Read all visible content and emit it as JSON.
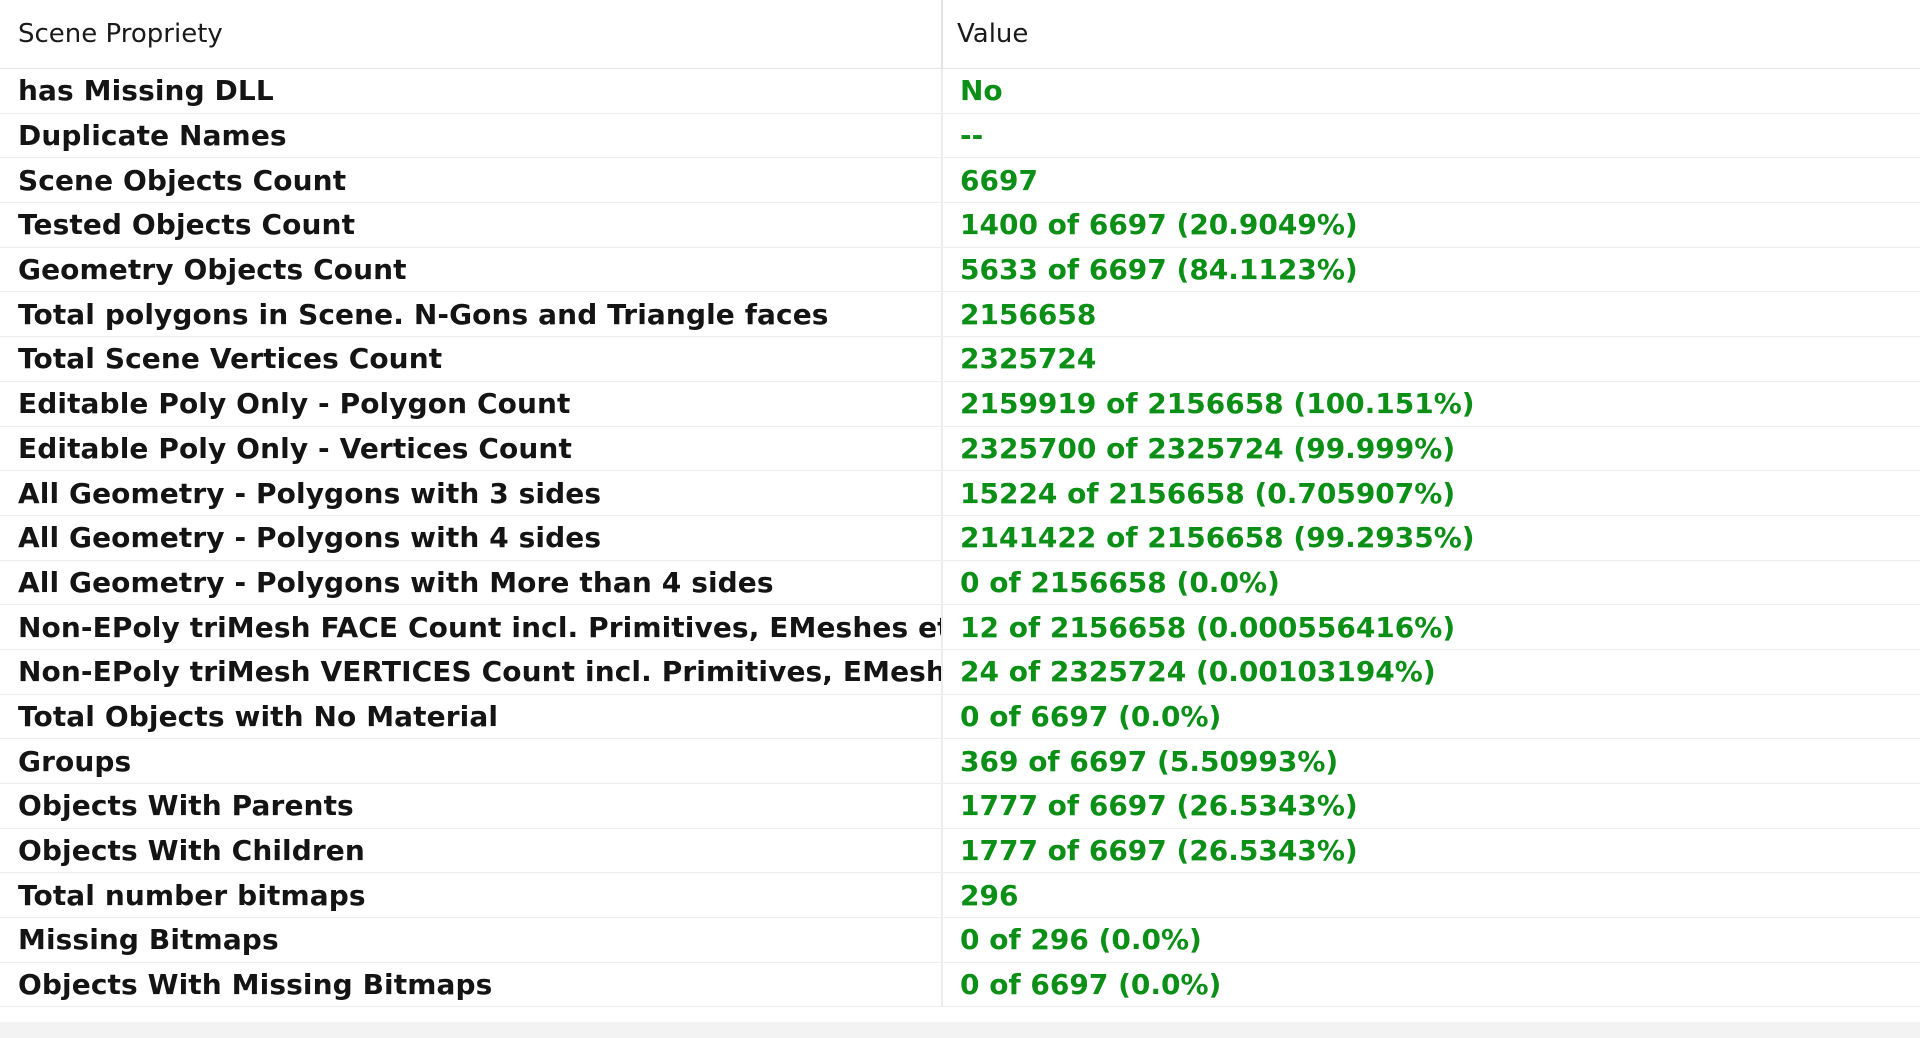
{
  "header": {
    "col_property": "Scene Propriety",
    "col_value": "Value"
  },
  "rows": [
    {
      "property": "has Missing DLL",
      "value": "No"
    },
    {
      "property": "Duplicate Names",
      "value": "--"
    },
    {
      "property": "Scene Objects Count",
      "value": "6697"
    },
    {
      "property": "Tested Objects Count",
      "value": "1400 of 6697 (20.9049%)"
    },
    {
      "property": "Geometry Objects Count",
      "value": "5633 of 6697 (84.1123%)"
    },
    {
      "property": "Total polygons in Scene. N-Gons and Triangle faces",
      "value": "2156658"
    },
    {
      "property": "Total Scene Vertices Count",
      "value": "2325724"
    },
    {
      "property": "Editable Poly Only - Polygon Count",
      "value": "2159919 of 2156658 (100.151%)"
    },
    {
      "property": "Editable Poly Only - Vertices Count",
      "value": "2325700 of 2325724 (99.999%)"
    },
    {
      "property": "All Geometry - Polygons with 3 sides",
      "value": "15224 of 2156658 (0.705907%)"
    },
    {
      "property": "All Geometry - Polygons with 4 sides",
      "value": "2141422 of 2156658 (99.2935%)"
    },
    {
      "property": "All Geometry - Polygons with More than 4 sides",
      "value": "0 of 2156658 (0.0%)"
    },
    {
      "property": "Non-EPoly triMesh FACE Count incl. Primitives, EMeshes etc...",
      "value": "12 of 2156658 (0.000556416%)"
    },
    {
      "property": "Non-EPoly triMesh VERTICES Count incl. Primitives, EMeshes ...",
      "value": "24 of 2325724 (0.00103194%)"
    },
    {
      "property": "Total Objects with No Material",
      "value": "0 of 6697 (0.0%)"
    },
    {
      "property": "Groups",
      "value": "369 of 6697 (5.50993%)"
    },
    {
      "property": "Objects With Parents",
      "value": "1777 of 6697 (26.5343%)"
    },
    {
      "property": "Objects With Children",
      "value": "1777 of 6697 (26.5343%)"
    },
    {
      "property": "Total number bitmaps",
      "value": "296"
    },
    {
      "property": "Missing Bitmaps",
      "value": "0 of 296 (0.0%)"
    },
    {
      "property": "Objects With Missing Bitmaps",
      "value": "0 of 6697 (0.0%)"
    }
  ],
  "colors": {
    "value_text": "#0b8f16",
    "property_text": "#141414"
  }
}
